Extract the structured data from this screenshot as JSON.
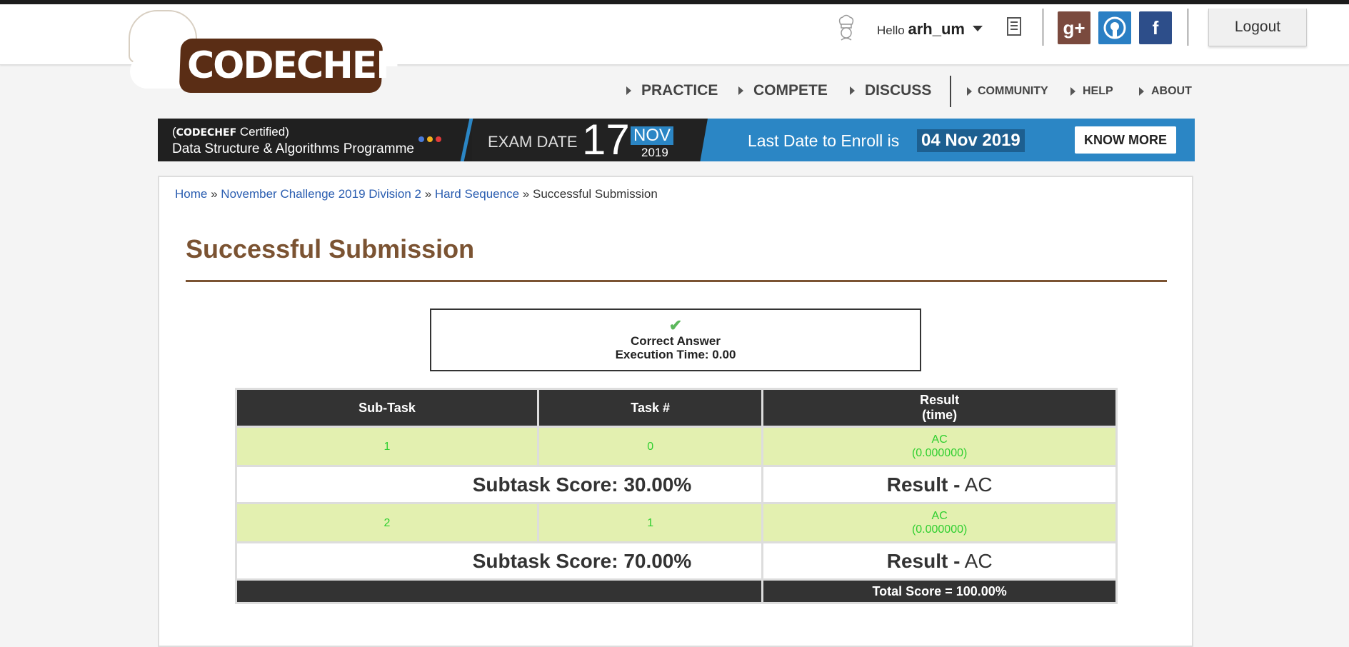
{
  "header": {
    "logo_text": "CODECHEF",
    "hello_prefix": "Hello",
    "username": "arh_um",
    "logout_label": "Logout",
    "social": [
      {
        "name": "google-plus",
        "glyph": "g+",
        "color": "#7a4a3e"
      },
      {
        "name": "github",
        "glyph": "●",
        "color": "#2a7fc4"
      },
      {
        "name": "facebook",
        "glyph": "f",
        "color": "#2d4e8a"
      }
    ]
  },
  "nav": {
    "primary": [
      "PRACTICE",
      "COMPETE",
      "DISCUSS"
    ],
    "secondary": [
      "COMMUNITY",
      "HELP",
      "ABOUT"
    ]
  },
  "banner": {
    "brand": "CODECHEF",
    "certified": "Certified",
    "programme": "Data Structure & Algorithms Programme",
    "exam_label": "EXAM DATE",
    "exam_day": "17",
    "exam_month": "NOV",
    "exam_year": "2019",
    "enroll_label": "Last Date to Enroll is",
    "enroll_date": "04 Nov 2019",
    "cta": "KNOW MORE",
    "dot_colors": [
      "#4a7bd8",
      "#f2b01e",
      "#e03a3a"
    ]
  },
  "breadcrumb": {
    "items": [
      "Home",
      "November Challenge 2019 Division 2",
      "Hard Sequence"
    ],
    "current": "Successful Submission",
    "sep": "»"
  },
  "page_title": "Successful Submission",
  "result": {
    "status": "Correct Answer",
    "exec_time": "Execution Time: 0.00"
  },
  "table": {
    "headers": [
      "Sub-Task",
      "Task #",
      "Result",
      "(time)"
    ],
    "rows": [
      {
        "subtask": "1",
        "task": "0",
        "result": "AC",
        "time": "(0.000000)",
        "score": "Subtask Score: 30.00%",
        "result_label": "Result -",
        "result_value": "AC"
      },
      {
        "subtask": "2",
        "task": "1",
        "result": "AC",
        "time": "(0.000000)",
        "score": "Subtask Score: 70.00%",
        "result_label": "Result -",
        "result_value": "AC"
      }
    ],
    "total": "Total Score = 100.00%"
  }
}
